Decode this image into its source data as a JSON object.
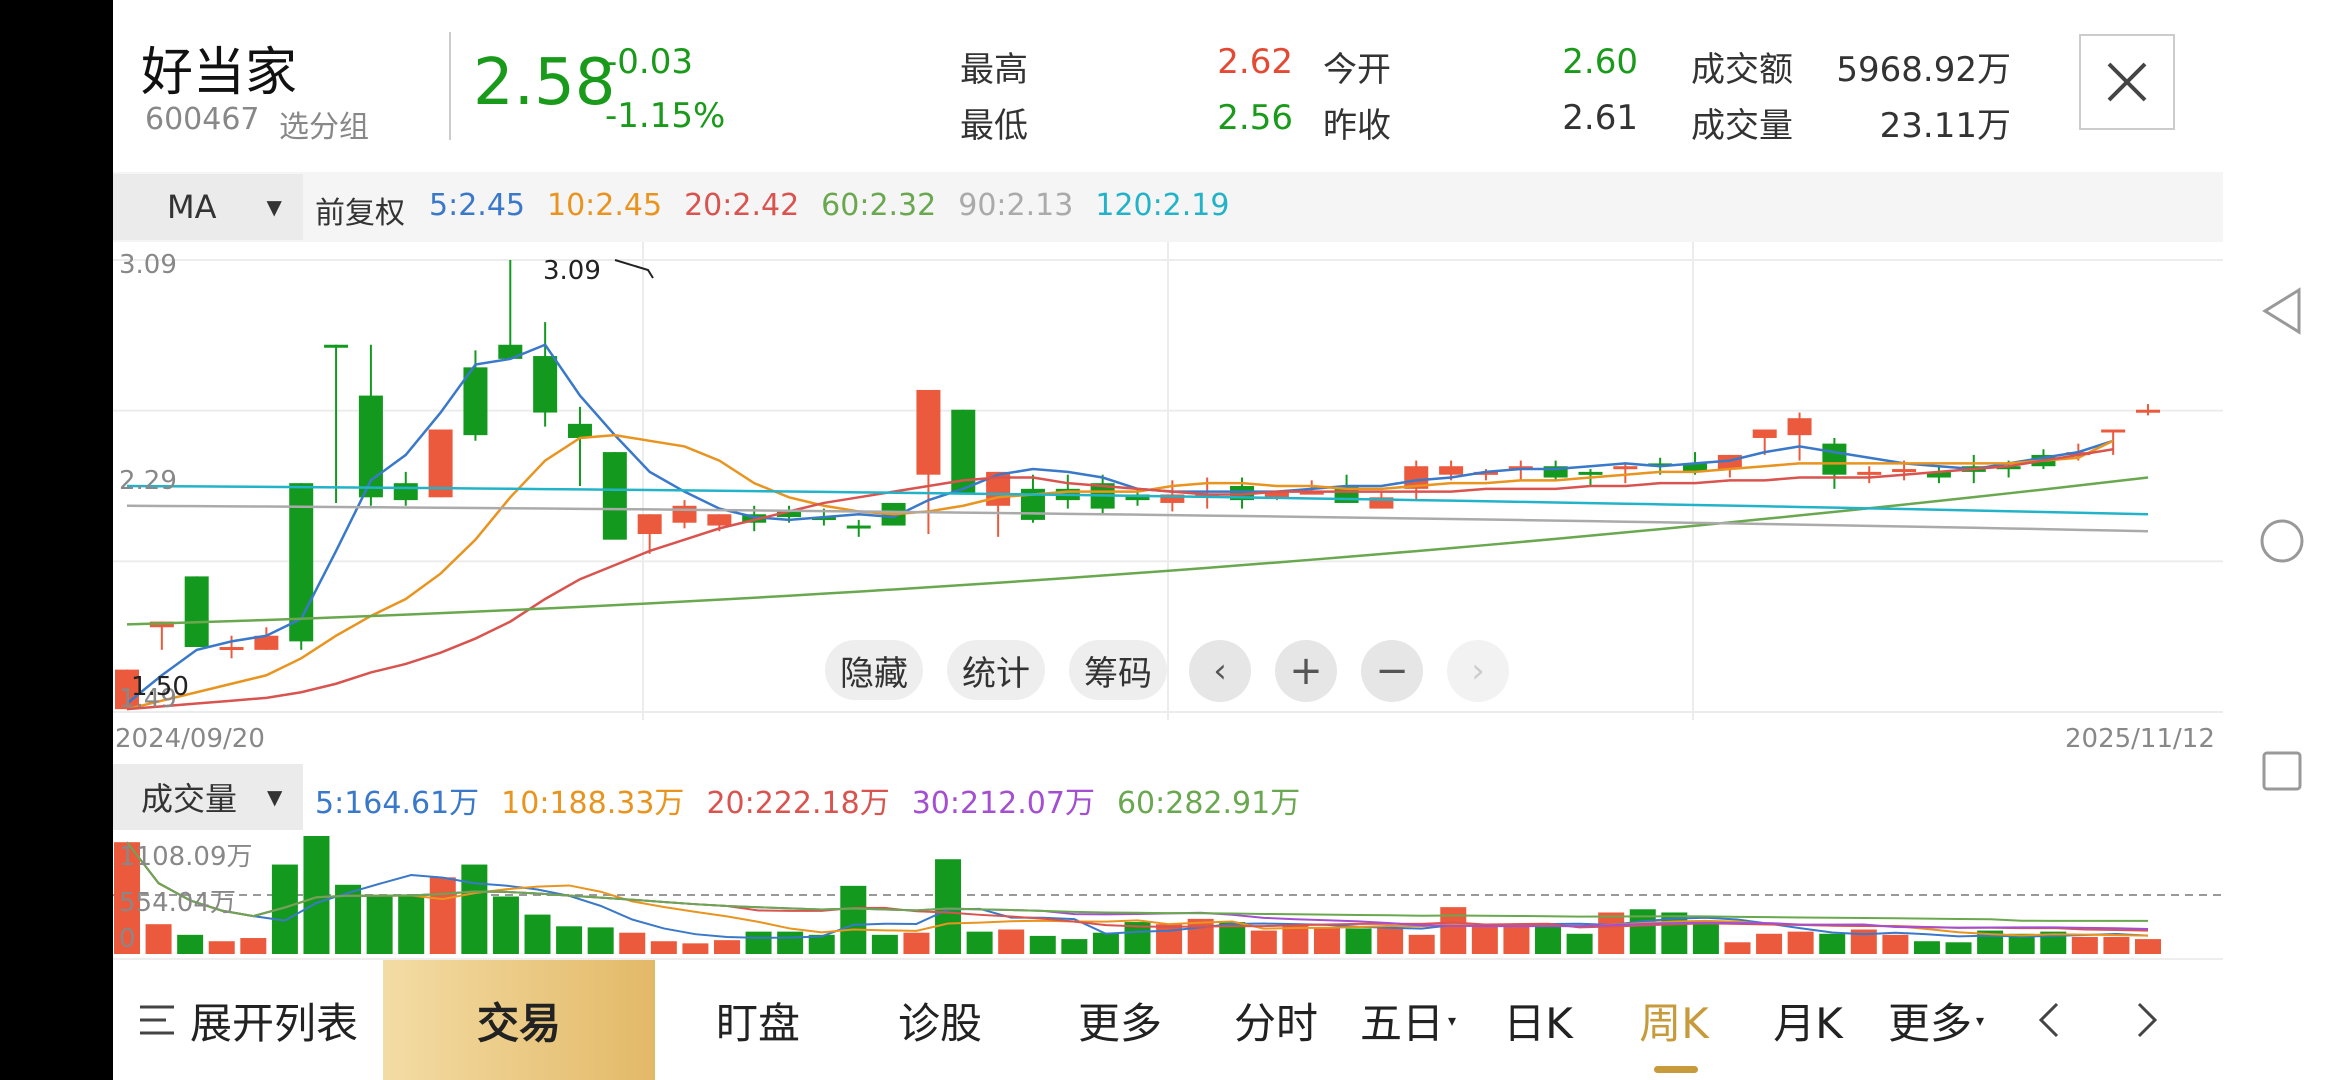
{
  "stock": {
    "name": "好当家",
    "code": "600467",
    "group_label": "选分组",
    "price": "2.58",
    "change": "-0.03",
    "change_pct": "-1.15%",
    "stats": {
      "high_label": "最高",
      "high": "2.62",
      "low_label": "最低",
      "low": "2.56",
      "open_label": "今开",
      "open": "2.60",
      "prev_close_label": "昨收",
      "prev_close": "2.61",
      "amount_label": "成交额",
      "amount": "5968.92万",
      "volume_label": "成交量",
      "volume": "23.11万"
    }
  },
  "toolbar": {
    "indicator": "MA",
    "adjust": "前复权",
    "ma_values": [
      {
        "text": "5:2.45",
        "color": "#3a78c9"
      },
      {
        "text": "10:2.45",
        "color": "#e8941f"
      },
      {
        "text": "20:2.42",
        "color": "#d9534f"
      },
      {
        "text": "60:2.32",
        "color": "#6aa84f"
      },
      {
        "text": "90:2.13",
        "color": "#aaaaaa"
      },
      {
        "text": "120:2.19",
        "color": "#22b3c8"
      }
    ]
  },
  "chart_labels": {
    "axis_top": "3.09",
    "axis_mid": "2.29",
    "axis_bottom": "1.49",
    "max_marker": "3.09",
    "min_marker": "1.50",
    "date_start": "2024/09/20",
    "date_end": "2025/11/12"
  },
  "chart_buttons": {
    "hide": "隐藏",
    "stats": "统计",
    "chips": "筹码"
  },
  "volume": {
    "indicator": "成交量",
    "ma_values": [
      {
        "text": "5:164.61万",
        "color": "#3a78c9"
      },
      {
        "text": "10:188.33万",
        "color": "#e8941f"
      },
      {
        "text": "20:222.18万",
        "color": "#d9534f"
      },
      {
        "text": "30:212.07万",
        "color": "#a44fd0"
      },
      {
        "text": "60:282.91万",
        "color": "#6aa84f"
      }
    ],
    "axis_top": "1108.09万",
    "axis_mid": "554.04万",
    "axis_zero": "0"
  },
  "bottom_tabs": {
    "expand": "展开列表",
    "trade": "交易",
    "watch": "盯盘",
    "diagnose": "诊股",
    "more": "更多",
    "intraday": "分时",
    "five_day": "五日",
    "daily": "日K",
    "weekly": "周K",
    "monthly": "月K",
    "more2": "更多"
  },
  "chart_data": {
    "type": "candlestick",
    "ylim": [
      1.49,
      3.09
    ],
    "candles": [
      {
        "o": 1.5,
        "h": 1.64,
        "l": 1.5,
        "c": 1.64
      },
      {
        "o": 1.79,
        "h": 1.81,
        "l": 1.71,
        "c": 1.81
      },
      {
        "o": 1.97,
        "h": 1.97,
        "l": 1.72,
        "c": 1.72
      },
      {
        "o": 1.72,
        "h": 1.76,
        "l": 1.68,
        "c": 1.72
      },
      {
        "o": 1.71,
        "h": 1.79,
        "l": 1.71,
        "c": 1.76
      },
      {
        "o": 2.3,
        "h": 2.3,
        "l": 1.71,
        "c": 1.74
      },
      {
        "o": 2.79,
        "h": 2.79,
        "l": 2.23,
        "c": 2.78
      },
      {
        "o": 2.61,
        "h": 2.79,
        "l": 2.22,
        "c": 2.25
      },
      {
        "o": 2.3,
        "h": 2.34,
        "l": 2.22,
        "c": 2.24
      },
      {
        "o": 2.25,
        "h": 2.29,
        "l": 2.25,
        "c": 2.49
      },
      {
        "o": 2.71,
        "h": 2.77,
        "l": 2.45,
        "c": 2.47
      },
      {
        "o": 2.79,
        "h": 3.09,
        "l": 2.74,
        "c": 2.74
      },
      {
        "o": 2.75,
        "h": 2.87,
        "l": 2.5,
        "c": 2.55
      },
      {
        "o": 2.51,
        "h": 2.57,
        "l": 2.29,
        "c": 2.46
      },
      {
        "o": 2.41,
        "h": 2.41,
        "l": 2.25,
        "c": 2.1
      },
      {
        "o": 2.12,
        "h": 2.19,
        "l": 2.05,
        "c": 2.19
      },
      {
        "o": 2.16,
        "h": 2.24,
        "l": 2.14,
        "c": 2.22
      },
      {
        "o": 2.15,
        "h": 2.19,
        "l": 2.13,
        "c": 2.19
      },
      {
        "o": 2.19,
        "h": 2.22,
        "l": 2.13,
        "c": 2.16
      },
      {
        "o": 2.2,
        "h": 2.22,
        "l": 2.16,
        "c": 2.18
      },
      {
        "o": 2.18,
        "h": 2.21,
        "l": 2.15,
        "c": 2.17
      },
      {
        "o": 2.15,
        "h": 2.17,
        "l": 2.11,
        "c": 2.14
      },
      {
        "o": 2.23,
        "h": 2.23,
        "l": 2.15,
        "c": 2.15
      },
      {
        "o": 2.33,
        "h": 2.63,
        "l": 2.12,
        "c": 2.63
      },
      {
        "o": 2.56,
        "h": 2.56,
        "l": 2.26,
        "c": 2.26
      },
      {
        "o": 2.22,
        "h": 2.34,
        "l": 2.11,
        "c": 2.34
      },
      {
        "o": 2.28,
        "h": 2.33,
        "l": 2.16,
        "c": 2.17
      },
      {
        "o": 2.28,
        "h": 2.33,
        "l": 2.21,
        "c": 2.24
      },
      {
        "o": 2.3,
        "h": 2.33,
        "l": 2.19,
        "c": 2.21
      },
      {
        "o": 2.26,
        "h": 2.28,
        "l": 2.22,
        "c": 2.24
      },
      {
        "o": 2.23,
        "h": 2.31,
        "l": 2.2,
        "c": 2.26
      },
      {
        "o": 2.25,
        "h": 2.32,
        "l": 2.21,
        "c": 2.26
      },
      {
        "o": 2.29,
        "h": 2.32,
        "l": 2.21,
        "c": 2.24
      },
      {
        "o": 2.25,
        "h": 2.27,
        "l": 2.24,
        "c": 2.27
      },
      {
        "o": 2.27,
        "h": 2.31,
        "l": 2.26,
        "c": 2.27
      },
      {
        "o": 2.29,
        "h": 2.33,
        "l": 2.24,
        "c": 2.23
      },
      {
        "o": 2.21,
        "h": 2.27,
        "l": 2.21,
        "c": 2.25
      },
      {
        "o": 2.28,
        "h": 2.38,
        "l": 2.24,
        "c": 2.36
      },
      {
        "o": 2.33,
        "h": 2.38,
        "l": 2.31,
        "c": 2.36
      },
      {
        "o": 2.34,
        "h": 2.35,
        "l": 2.31,
        "c": 2.34
      },
      {
        "o": 2.35,
        "h": 2.38,
        "l": 2.31,
        "c": 2.36
      },
      {
        "o": 2.36,
        "h": 2.38,
        "l": 2.31,
        "c": 2.32
      },
      {
        "o": 2.34,
        "h": 2.35,
        "l": 2.29,
        "c": 2.33
      },
      {
        "o": 2.35,
        "h": 2.37,
        "l": 2.3,
        "c": 2.36
      },
      {
        "o": 2.37,
        "h": 2.39,
        "l": 2.33,
        "c": 2.36
      },
      {
        "o": 2.37,
        "h": 2.41,
        "l": 2.33,
        "c": 2.34
      },
      {
        "o": 2.35,
        "h": 2.4,
        "l": 2.32,
        "c": 2.4
      },
      {
        "o": 2.46,
        "h": 2.49,
        "l": 2.4,
        "c": 2.49
      },
      {
        "o": 2.47,
        "h": 2.55,
        "l": 2.38,
        "c": 2.53
      },
      {
        "o": 2.44,
        "h": 2.46,
        "l": 2.28,
        "c": 2.33
      },
      {
        "o": 2.33,
        "h": 2.36,
        "l": 2.3,
        "c": 2.34
      },
      {
        "o": 2.35,
        "h": 2.38,
        "l": 2.31,
        "c": 2.35
      },
      {
        "o": 2.34,
        "h": 2.36,
        "l": 2.3,
        "c": 2.32
      },
      {
        "o": 2.36,
        "h": 2.4,
        "l": 2.3,
        "c": 2.34
      },
      {
        "o": 2.36,
        "h": 2.38,
        "l": 2.32,
        "c": 2.35
      },
      {
        "o": 2.4,
        "h": 2.42,
        "l": 2.35,
        "c": 2.36
      },
      {
        "o": 2.41,
        "h": 2.44,
        "l": 2.38,
        "c": 2.41
      },
      {
        "o": 2.49,
        "h": 2.49,
        "l": 2.4,
        "c": 2.49
      },
      {
        "o": 2.56,
        "h": 2.58,
        "l": 2.54,
        "c": 2.56
      }
    ],
    "volume": [
      1050,
      280,
      180,
      120,
      150,
      840,
      1108,
      650,
      550,
      560,
      720,
      840,
      540,
      370,
      260,
      250,
      200,
      120,
      100,
      130,
      210,
      210,
      180,
      640,
      180,
      200,
      890,
      210,
      230,
      170,
      140,
      200,
      300,
      280,
      330,
      300,
      220,
      270,
      250,
      240,
      250,
      180,
      440,
      260,
      260,
      270,
      190,
      390,
      420,
      390,
      310,
      110,
      190,
      210,
      190,
      230,
      180,
      120,
      110,
      220,
      190,
      210,
      160,
      160,
      140
    ],
    "volume_ylim": [
      0,
      1108.09
    ],
    "ma_lines": {
      "ma5": [
        1.52,
        1.62,
        1.71,
        1.74,
        1.76,
        1.82,
        2.06,
        2.31,
        2.4,
        2.55,
        2.72,
        2.74,
        2.79,
        2.61,
        2.47,
        2.34,
        2.27,
        2.21,
        2.18,
        2.17,
        2.18,
        2.19,
        2.18,
        2.24,
        2.28,
        2.33,
        2.35,
        2.34,
        2.32,
        2.28,
        2.27,
        2.27,
        2.27,
        2.27,
        2.28,
        2.29,
        2.29,
        2.31,
        2.32,
        2.34,
        2.35,
        2.35,
        2.36,
        2.37,
        2.36,
        2.37,
        2.38,
        2.41,
        2.43,
        2.41,
        2.39,
        2.37,
        2.36,
        2.35,
        2.37,
        2.39,
        2.41,
        2.45
      ],
      "ma10": [
        1.5,
        1.53,
        1.56,
        1.59,
        1.62,
        1.68,
        1.76,
        1.83,
        1.89,
        1.98,
        2.1,
        2.25,
        2.38,
        2.46,
        2.47,
        2.45,
        2.43,
        2.38,
        2.3,
        2.25,
        2.22,
        2.2,
        2.19,
        2.2,
        2.22,
        2.25,
        2.26,
        2.27,
        2.27,
        2.27,
        2.29,
        2.3,
        2.3,
        2.29,
        2.29,
        2.28,
        2.28,
        2.29,
        2.3,
        2.3,
        2.31,
        2.31,
        2.32,
        2.33,
        2.34,
        2.34,
        2.35,
        2.36,
        2.37,
        2.37,
        2.37,
        2.37,
        2.37,
        2.37,
        2.37,
        2.38,
        2.39,
        2.45
      ],
      "ma20": [
        1.5,
        1.51,
        1.52,
        1.53,
        1.54,
        1.56,
        1.59,
        1.63,
        1.66,
        1.7,
        1.75,
        1.81,
        1.89,
        1.96,
        2.01,
        2.06,
        2.1,
        2.14,
        2.17,
        2.2,
        2.23,
        2.25,
        2.27,
        2.29,
        2.31,
        2.32,
        2.32,
        2.3,
        2.29,
        2.28,
        2.27,
        2.26,
        2.26,
        2.27,
        2.27,
        2.27,
        2.27,
        2.27,
        2.27,
        2.28,
        2.28,
        2.28,
        2.29,
        2.29,
        2.3,
        2.3,
        2.31,
        2.31,
        2.32,
        2.32,
        2.32,
        2.33,
        2.34,
        2.35,
        2.36,
        2.38,
        2.4,
        2.42
      ]
    }
  }
}
